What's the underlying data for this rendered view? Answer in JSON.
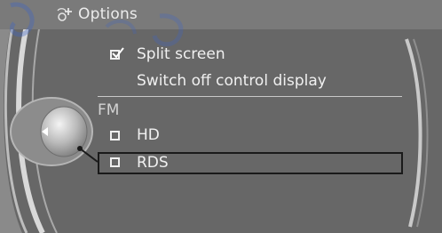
{
  "header": {
    "title": "Options",
    "icon": "settings-star-icon"
  },
  "menu": {
    "items": [
      {
        "label": "Split screen",
        "checkbox": true,
        "checked": true
      },
      {
        "label": "Switch off control display",
        "checkbox": false
      }
    ],
    "section_label": "FM",
    "fm_items": [
      {
        "label": "HD",
        "checkbox": true,
        "checked": false
      },
      {
        "label": "RDS",
        "checkbox": true,
        "checked": false,
        "selected": true
      }
    ]
  },
  "colors": {
    "background": "#676767",
    "titlebar": "#7a7a7a",
    "text": "#f0f0f0",
    "selection_border": "#1a1a1a"
  }
}
